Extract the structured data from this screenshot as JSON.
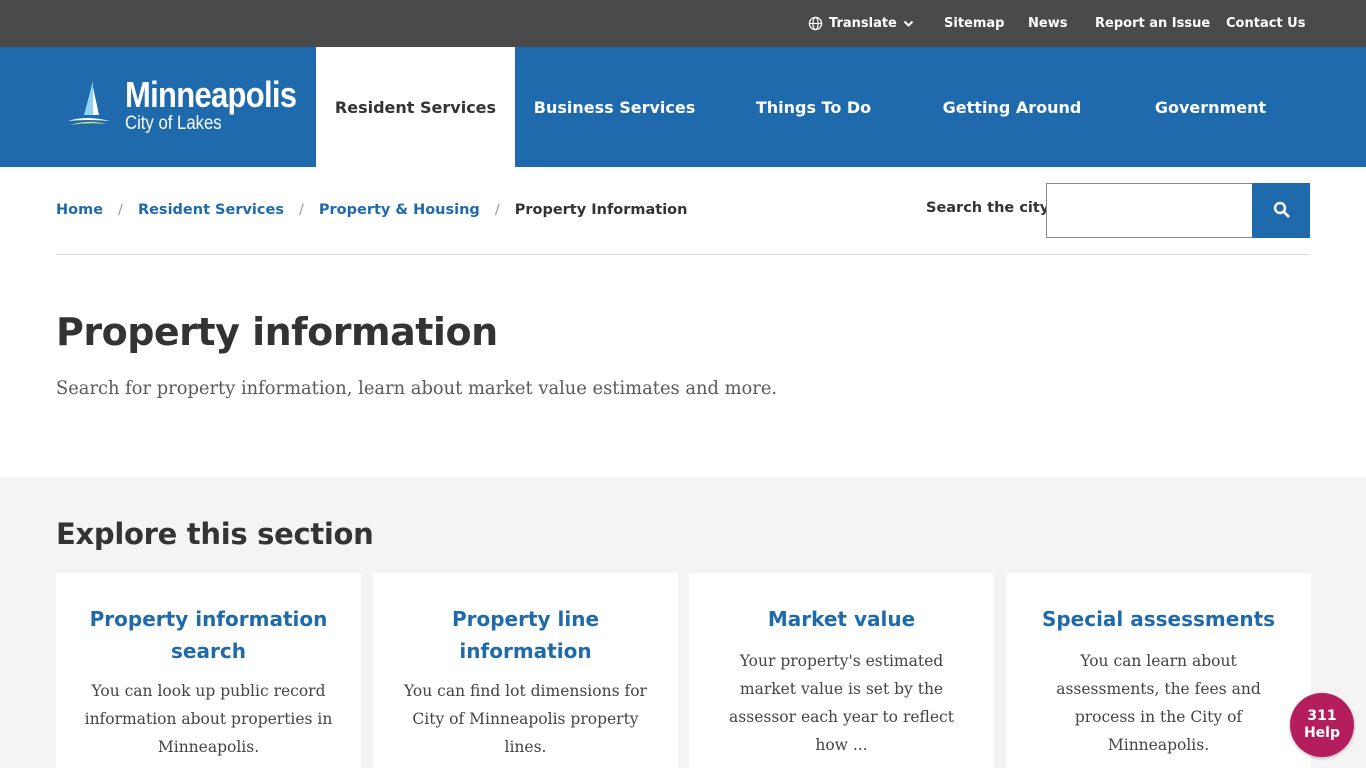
{
  "utility_bar": {
    "translate_label": "Translate",
    "links": {
      "sitemap": "Sitemap",
      "news": "News",
      "report": "Report an Issue",
      "contact": "Contact Us"
    }
  },
  "logo": {
    "title": "Minneapolis",
    "subtitle": "City of Lakes"
  },
  "nav": {
    "items": [
      {
        "label": "Resident Services",
        "active": true
      },
      {
        "label": "Business Services",
        "active": false
      },
      {
        "label": "Things To Do",
        "active": false
      },
      {
        "label": "Getting Around",
        "active": false
      },
      {
        "label": "Government",
        "active": false
      }
    ]
  },
  "breadcrumb": {
    "items": [
      "Home",
      "Resident Services",
      "Property & Housing"
    ],
    "current": "Property Information",
    "separator": "/"
  },
  "search": {
    "label": "Search the city",
    "value": "",
    "placeholder": ""
  },
  "page": {
    "title": "Property information",
    "lead": "Search for property information, learn about market value estimates and more."
  },
  "explore": {
    "title": "Explore this section",
    "cards": [
      {
        "title": "Property information search",
        "desc": "You can look up public record information about properties in Minneapolis."
      },
      {
        "title": "Property line information",
        "desc": "You can find lot dimensions for City of Minneapolis property lines."
      },
      {
        "title": "Market value",
        "desc": "Your property's estimated market value is set by the assessor each year to reflect how ..."
      },
      {
        "title": "Special assessments",
        "desc": "You can learn about assessments, the fees and process in the City of Minneapolis."
      }
    ]
  },
  "help_badge": {
    "number": "311",
    "label": "Help"
  },
  "colors": {
    "brand_blue": "#1f6aad",
    "utility_gray": "#4a4a4a",
    "help_magenta": "#b51e5c",
    "section_bg": "#f3f4f3"
  },
  "icons": {
    "translate": "globe-icon",
    "translate_caret": "chevron-down-icon",
    "search": "search-icon",
    "logo": "sailboat-logo-icon"
  }
}
